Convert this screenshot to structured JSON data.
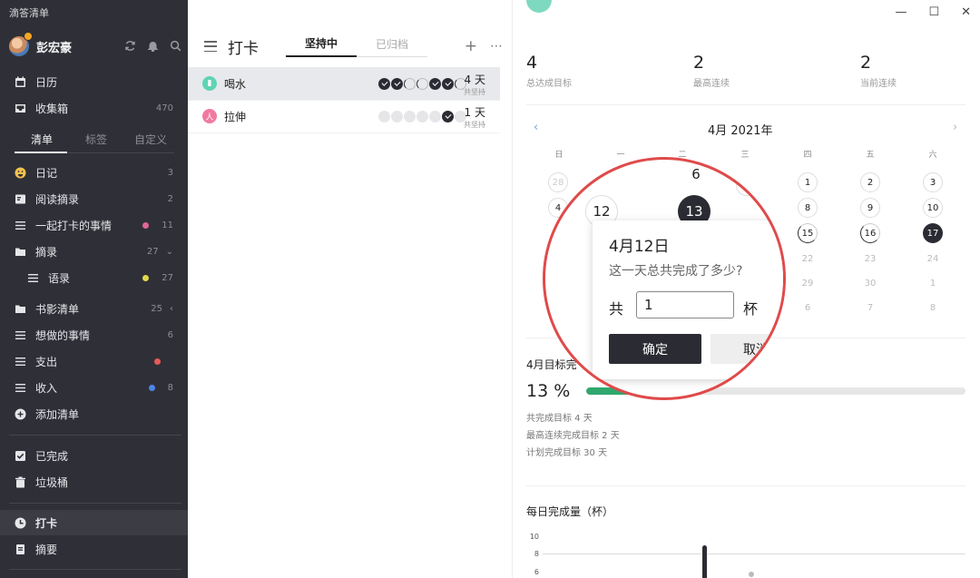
{
  "app": {
    "title": "滴答清单"
  },
  "user": {
    "name": "彭宏豪"
  },
  "sidebar": {
    "calendar": "日历",
    "inbox": {
      "label": "收集箱",
      "count": "470"
    },
    "tabs": [
      "清单",
      "标签",
      "自定义"
    ],
    "lists": [
      {
        "label": "日记",
        "count": "3"
      },
      {
        "label": "阅读摘录",
        "count": "2"
      },
      {
        "label": "一起打卡的事情",
        "count": "11",
        "dot": "#e0659a"
      },
      {
        "label": "摘录",
        "count": "27"
      },
      {
        "label": "语录",
        "count": "27",
        "dot": "#e2d84a"
      },
      {
        "label": "书影清单",
        "count": "25"
      },
      {
        "label": "想做的事情",
        "count": "6"
      },
      {
        "label": "支出",
        "dot": "#e65a5a"
      },
      {
        "label": "收入",
        "count": "8",
        "dot": "#4d86e8"
      },
      {
        "label": "添加清单"
      }
    ],
    "completed": "已完成",
    "trash": "垃圾桶",
    "checkin": "打卡",
    "summary": "摘要"
  },
  "middle": {
    "title": "打卡",
    "tabs": [
      "坚持中",
      "已归档"
    ],
    "habits": [
      {
        "name": "喝水",
        "days": "4 天",
        "sub": "共坚持",
        "color": "#5fd3b5"
      },
      {
        "name": "拉伸",
        "days": "1 天",
        "sub": "共坚持",
        "color": "#f07aa0"
      }
    ]
  },
  "detail": {
    "stats": [
      {
        "num": "4",
        "label": "总达成目标"
      },
      {
        "num": "2",
        "label": "最高连续"
      },
      {
        "num": "2",
        "label": "当前连续"
      }
    ],
    "calendar": {
      "month": "4月 2021年",
      "weekdays": [
        "日",
        "一",
        "二",
        "三",
        "四",
        "五",
        "六"
      ]
    },
    "goal": {
      "title": "4月目标完",
      "percent": "13 %",
      "progress": 0.13,
      "lines": [
        "共完成目标 4 天",
        "最高连续完成目标 2 天",
        "计划完成目标 30 天"
      ]
    },
    "daily": {
      "title": "每日完成量（杯）",
      "ticks": [
        "10",
        "8",
        "6"
      ]
    }
  },
  "popup": {
    "date": "4月12日",
    "question": "这一天总共完成了多少?",
    "prefix": "共",
    "value": "1",
    "unit": "杯",
    "confirm": "确定",
    "cancel": "取消"
  },
  "chart_data": {
    "type": "bar",
    "title": "每日完成量（杯）",
    "ylim": [
      0,
      10
    ],
    "y_ticks": [
      10,
      8,
      6
    ]
  }
}
